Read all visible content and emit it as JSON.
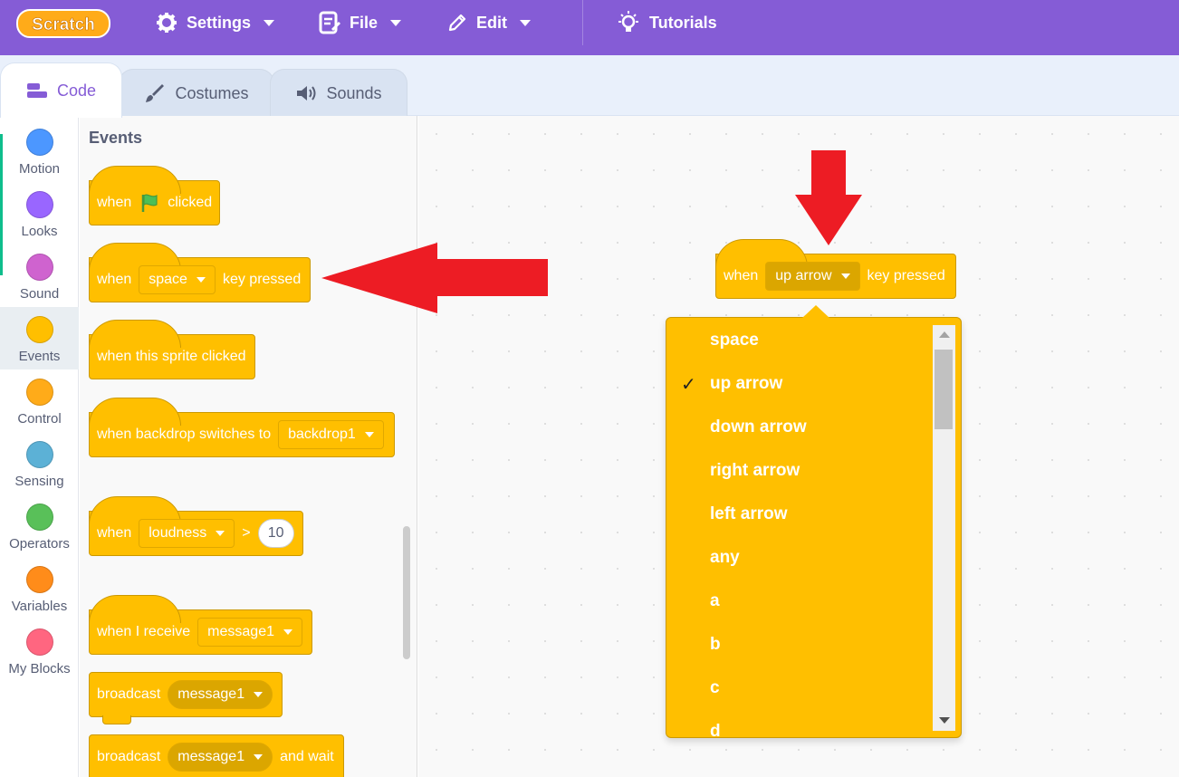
{
  "menubar": {
    "logo": "Scratch",
    "settings": "Settings",
    "file": "File",
    "edit": "Edit",
    "tutorials": "Tutorials"
  },
  "tabs": [
    {
      "label": "Code",
      "icon": "code-icon"
    },
    {
      "label": "Costumes",
      "icon": "brush-icon"
    },
    {
      "label": "Sounds",
      "icon": "speaker-icon"
    }
  ],
  "categories": [
    {
      "label": "Motion",
      "color": "#4c97ff"
    },
    {
      "label": "Looks",
      "color": "#9966ff"
    },
    {
      "label": "Sound",
      "color": "#cf63cf"
    },
    {
      "label": "Events",
      "color": "#ffbf00"
    },
    {
      "label": "Control",
      "color": "#ffab19"
    },
    {
      "label": "Sensing",
      "color": "#5cb1d6"
    },
    {
      "label": "Operators",
      "color": "#59c059"
    },
    {
      "label": "Variables",
      "color": "#ff8c1a"
    },
    {
      "label": "My Blocks",
      "color": "#ff6680"
    }
  ],
  "palette": {
    "heading": "Events",
    "flag_block": {
      "when": "when",
      "clicked": "clicked"
    },
    "key_block": {
      "when": "when",
      "key": "space",
      "suffix": "key pressed"
    },
    "sprite_block": {
      "text": "when this sprite clicked"
    },
    "backdrop_block": {
      "text": "when backdrop switches to",
      "value": "backdrop1"
    },
    "loudness_block": {
      "when": "when",
      "sensor": "loudness",
      "op": ">",
      "value": "10"
    },
    "receive_block": {
      "text": "when I receive",
      "value": "message1"
    },
    "broadcast_block": {
      "text": "broadcast",
      "value": "message1"
    },
    "broadcast_wait_block": {
      "text": "broadcast",
      "value": "message1",
      "suffix": "and wait"
    }
  },
  "workspace_block": {
    "when": "when",
    "key": "up arrow",
    "suffix": "key pressed"
  },
  "dropdown": {
    "selected": "up arrow",
    "items": [
      "space",
      "up arrow",
      "down arrow",
      "right arrow",
      "left arrow",
      "any",
      "a",
      "b",
      "c",
      "d"
    ]
  },
  "colors": {
    "menubar": "#855cd6",
    "events": "#ffbf00",
    "annotation": "#ed1c24"
  }
}
